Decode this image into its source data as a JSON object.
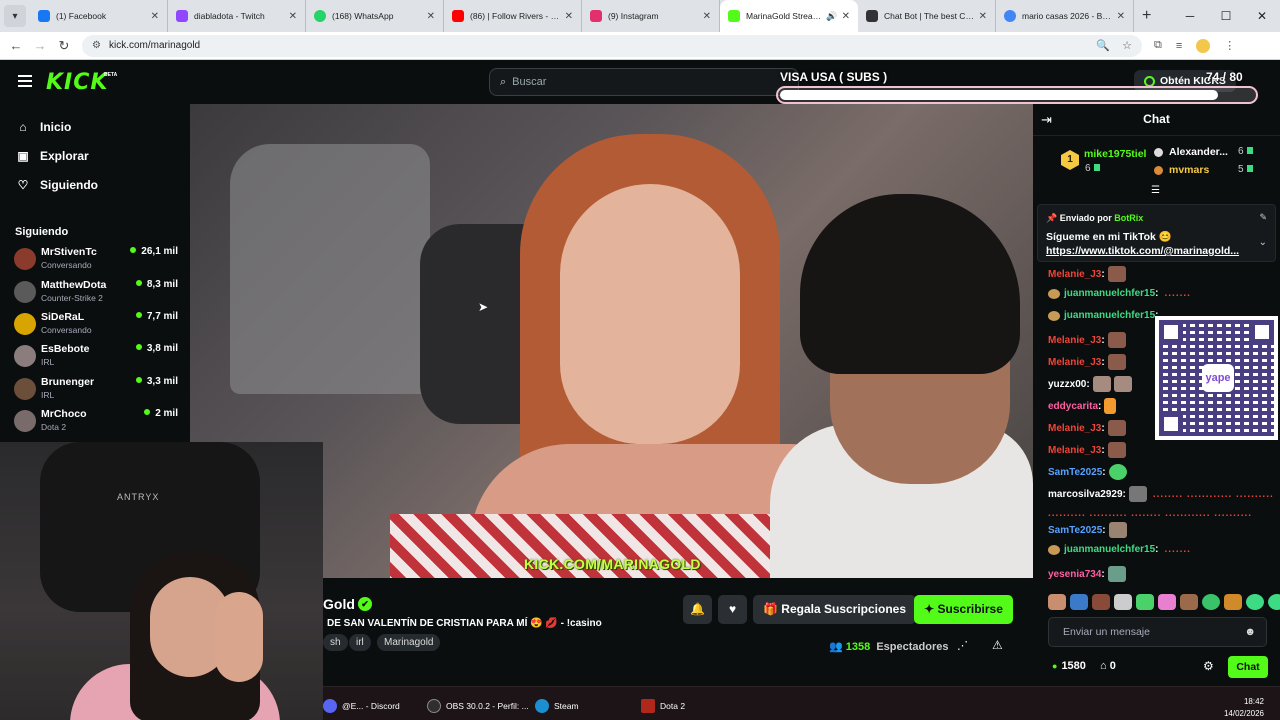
{
  "browser": {
    "tabs": [
      {
        "label": "(1) Facebook",
        "color": "#1877f2"
      },
      {
        "label": "diabladota - Twitch",
        "color": "#9146ff"
      },
      {
        "label": "(168) WhatsApp",
        "color": "#25d366"
      },
      {
        "label": "(86) | Follow Rivers - Lykk",
        "color": "#ff0000"
      },
      {
        "label": "(9) Instagram",
        "color": "#e1306c"
      },
      {
        "label": "MarinaGold Stream -",
        "color": "#53fc18"
      },
      {
        "label": "Chat Bot | The best ChatB",
        "color": "#333333"
      },
      {
        "label": "mario casas 2026 - Busca",
        "color": "#4285f4"
      }
    ],
    "new_tab_symbol": "+",
    "url": "kick.com/marinagold"
  },
  "kick": {
    "logo": "KICK",
    "logo_badge": "BETA",
    "search_placeholder": "Buscar",
    "get_kicks": "Obtén KICKS"
  },
  "goal": {
    "title": "VISA USA ( SUBS )",
    "count": "74 / 80",
    "progress_fraction": 0.925
  },
  "sidebar": {
    "nav": [
      {
        "label": "Inicio",
        "icon": "home-icon"
      },
      {
        "label": "Explorar",
        "icon": "compass-icon"
      },
      {
        "label": "Siguiendo",
        "icon": "heart-icon"
      }
    ],
    "following_title": "Siguiendo",
    "channels": [
      {
        "name": "MrStivenTc",
        "sub": "Conversando",
        "viewers": "26,1 mil",
        "color": "#8a3b2b"
      },
      {
        "name": "MatthewDota",
        "sub": "Counter-Strike 2",
        "viewers": "8,3 mil",
        "color": "#5a5a5a"
      },
      {
        "name": "SiDeRaL",
        "sub": "Conversando",
        "viewers": "7,7 mil",
        "color": "#d8a400"
      },
      {
        "name": "EsBebote",
        "sub": "IRL",
        "viewers": "3,8 mil",
        "color": "#8b7d7d"
      },
      {
        "name": "Brunenger",
        "sub": "IRL",
        "viewers": "3,3 mil",
        "color": "#6b4f3a"
      },
      {
        "name": "MrChoco",
        "sub": "Dota 2",
        "viewers": "2 mil",
        "color": "#7a6b6b"
      }
    ]
  },
  "video": {
    "watermark": "KICK.COM/MARINAGOLD",
    "webcam_brand": "ANTRYX"
  },
  "stream": {
    "name": "Gold",
    "verified": "✔",
    "title": "DE SAN VALENTÍN DE CRISTIAN PARA MÍ 😍 💋 - !casino",
    "tags": [
      "sh",
      "irl",
      "Marinagold"
    ],
    "gift_label": "Regala Suscripciones",
    "subscribe_label": "Suscribirse",
    "viewers": "1358",
    "viewers_label": "Espectadores"
  },
  "chat": {
    "title": "Chat",
    "leaderboard": [
      {
        "rank": "1",
        "name": "mike1975tiel",
        "count": "6"
      },
      {
        "name": "Alexander...",
        "count": "6"
      },
      {
        "name": "mvmars",
        "count": "5"
      }
    ],
    "pinned": {
      "sent_by": "Enviado por",
      "bot": "BotRix",
      "text": "Sígueme en mi TikTok 😊",
      "link": "https://www.tiktok.com/@marinagold..."
    },
    "messages": [
      {
        "user": "Melanie_J3",
        "color": "#f04438"
      },
      {
        "user": "juanmanuelchfer15",
        "color": "#3ddc84"
      },
      {
        "user": "juanmanuelchfer15",
        "color": "#3ddc84"
      },
      {
        "user": "Melanie_J3",
        "color": "#f04438"
      },
      {
        "user": "Melanie_J3",
        "color": "#f04438"
      },
      {
        "user": "yuzzx00",
        "color": "#ffffff"
      },
      {
        "user": "eddycarita",
        "color": "#ff5fa2"
      },
      {
        "user": "Melanie_J3",
        "color": "#f04438"
      },
      {
        "user": "Melanie_J3",
        "color": "#f04438"
      },
      {
        "user": "SamTe2025",
        "color": "#5aa2ff"
      },
      {
        "user": "marcosilva2929",
        "color": "#ffffff"
      },
      {
        "user": "SamTe2025",
        "color": "#5aa2ff"
      },
      {
        "user": "juanmanuelchfer15",
        "color": "#3ddc84"
      },
      {
        "user": "yesenia734",
        "color": "#ff5fa2"
      }
    ],
    "qr_logo": "yape",
    "input_placeholder": "Enviar un mensaje",
    "kick_points": "1580",
    "gifts_count": "0",
    "chat_button": "Chat"
  },
  "taskbar": {
    "apps": [
      {
        "label": "@E... - Discord",
        "color": "#5865f2"
      },
      {
        "label": "OBS 30.0.2 - Perfil: ...",
        "color": "#302e31"
      },
      {
        "label": "Steam",
        "color": "#1b8fd1"
      },
      {
        "label": "Dota 2",
        "color": "#b0281c"
      }
    ],
    "time": "18:42",
    "date": "14/02/2026"
  }
}
